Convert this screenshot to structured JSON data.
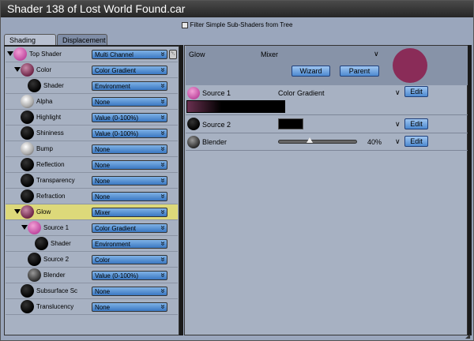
{
  "window": {
    "title": "Shader 138 of Lost World Found.car"
  },
  "filter": {
    "label": "Filter Simple Sub-Shaders from Tree"
  },
  "tabs": [
    {
      "label": "Shading"
    },
    {
      "label": "Displacement"
    }
  ],
  "tree": [
    {
      "label": "Top Shader",
      "value": "Multi Channel",
      "depth": 0,
      "ball": "pk",
      "expanded": true
    },
    {
      "label": "Color",
      "value": "Color Gradient",
      "depth": 1,
      "ball": "mv",
      "expanded": true
    },
    {
      "label": "Shader",
      "value": "Environment",
      "depth": 2,
      "ball": "bk"
    },
    {
      "label": "Alpha",
      "value": "None",
      "depth": 1,
      "ball": "wh"
    },
    {
      "label": "Highlight",
      "value": "Value (0-100%)",
      "depth": 1,
      "ball": "bk"
    },
    {
      "label": "Shininess",
      "value": "Value (0-100%)",
      "depth": 1,
      "ball": "bk"
    },
    {
      "label": "Bump",
      "value": "None",
      "depth": 1,
      "ball": "wh"
    },
    {
      "label": "Reflection",
      "value": "None",
      "depth": 1,
      "ball": "bk"
    },
    {
      "label": "Transparency",
      "value": "None",
      "depth": 1,
      "ball": "bk"
    },
    {
      "label": "Refraction",
      "value": "None",
      "depth": 1,
      "ball": "bk"
    },
    {
      "label": "Glow",
      "value": "Mixer",
      "depth": 1,
      "ball": "mv",
      "expanded": true,
      "selected": true
    },
    {
      "label": "Source 1",
      "value": "Color Gradient",
      "depth": 2,
      "ball": "pk",
      "expanded": true
    },
    {
      "label": "Shader",
      "value": "Environment",
      "depth": 3,
      "ball": "bk"
    },
    {
      "label": "Source 2",
      "value": "Color",
      "depth": 2,
      "ball": "bk"
    },
    {
      "label": "Blender",
      "value": "Value (0-100%)",
      "depth": 2,
      "ball": "gy"
    },
    {
      "label": "Subsurface Sc",
      "value": "None",
      "depth": 1,
      "ball": "bk"
    },
    {
      "label": "Translucency",
      "value": "None",
      "depth": 1,
      "ball": "bk"
    }
  ],
  "detail": {
    "channel": "Glow",
    "type": "Mixer",
    "wizard": "Wizard",
    "parent": "Parent",
    "source1": {
      "label": "Source 1",
      "value": "Color Gradient",
      "edit": "Edit"
    },
    "source2": {
      "label": "Source 2",
      "edit": "Edit"
    },
    "blender": {
      "label": "Blender",
      "percent": "40%",
      "level": 0.4,
      "edit": "Edit"
    }
  }
}
